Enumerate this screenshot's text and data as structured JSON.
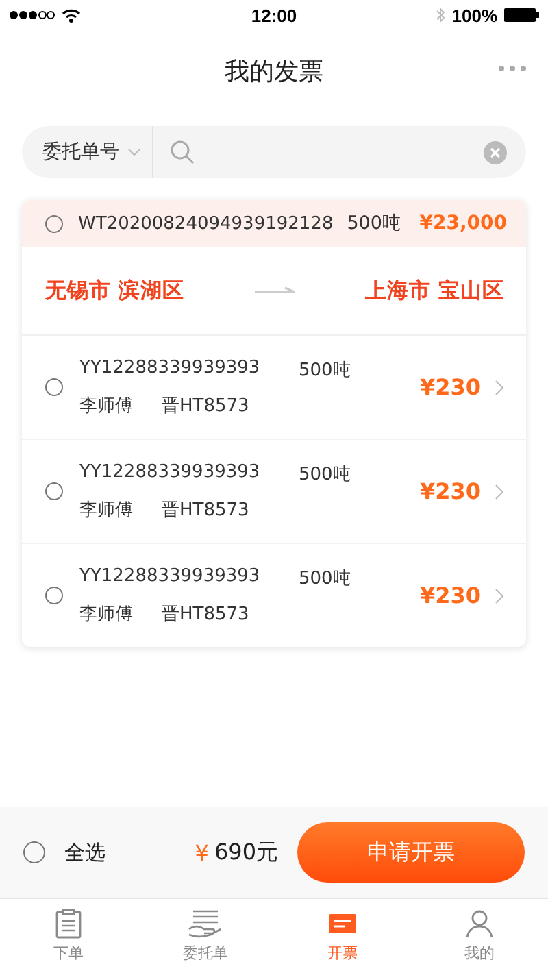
{
  "status_bar": {
    "time": "12:00",
    "battery": "100%"
  },
  "nav": {
    "title": "我的发票"
  },
  "search": {
    "filter": "委托单号"
  },
  "order": {
    "selected": false,
    "number": "WT20200824094939192128",
    "weight": "500吨",
    "amount": "¥23,000",
    "from": "无锡市 滨湖区",
    "to": "上海市 宝山区",
    "items": [
      {
        "selected": false,
        "number": "YY12288339939393",
        "weight": "500吨",
        "driver": "李师傅",
        "plate": "晋HT8573",
        "amount": "¥230"
      },
      {
        "selected": false,
        "number": "YY12288339939393",
        "weight": "500吨",
        "driver": "李师傅",
        "plate": "晋HT8573",
        "amount": "¥230"
      },
      {
        "selected": false,
        "number": "YY12288339939393",
        "weight": "500吨",
        "driver": "李师傅",
        "plate": "晋HT8573",
        "amount": "¥230"
      }
    ]
  },
  "footer": {
    "select_all": {
      "label": "全选",
      "selected": false
    },
    "currency": "¥",
    "total": "690元",
    "button": "申请开票"
  },
  "tabs": [
    {
      "kind": "order",
      "label": "下单",
      "selected": false
    },
    {
      "kind": "entrust",
      "label": "委托单",
      "selected": false
    },
    {
      "kind": "invoice",
      "label": "开票",
      "selected": true
    },
    {
      "kind": "mine",
      "label": "我的",
      "selected": false
    }
  ]
}
